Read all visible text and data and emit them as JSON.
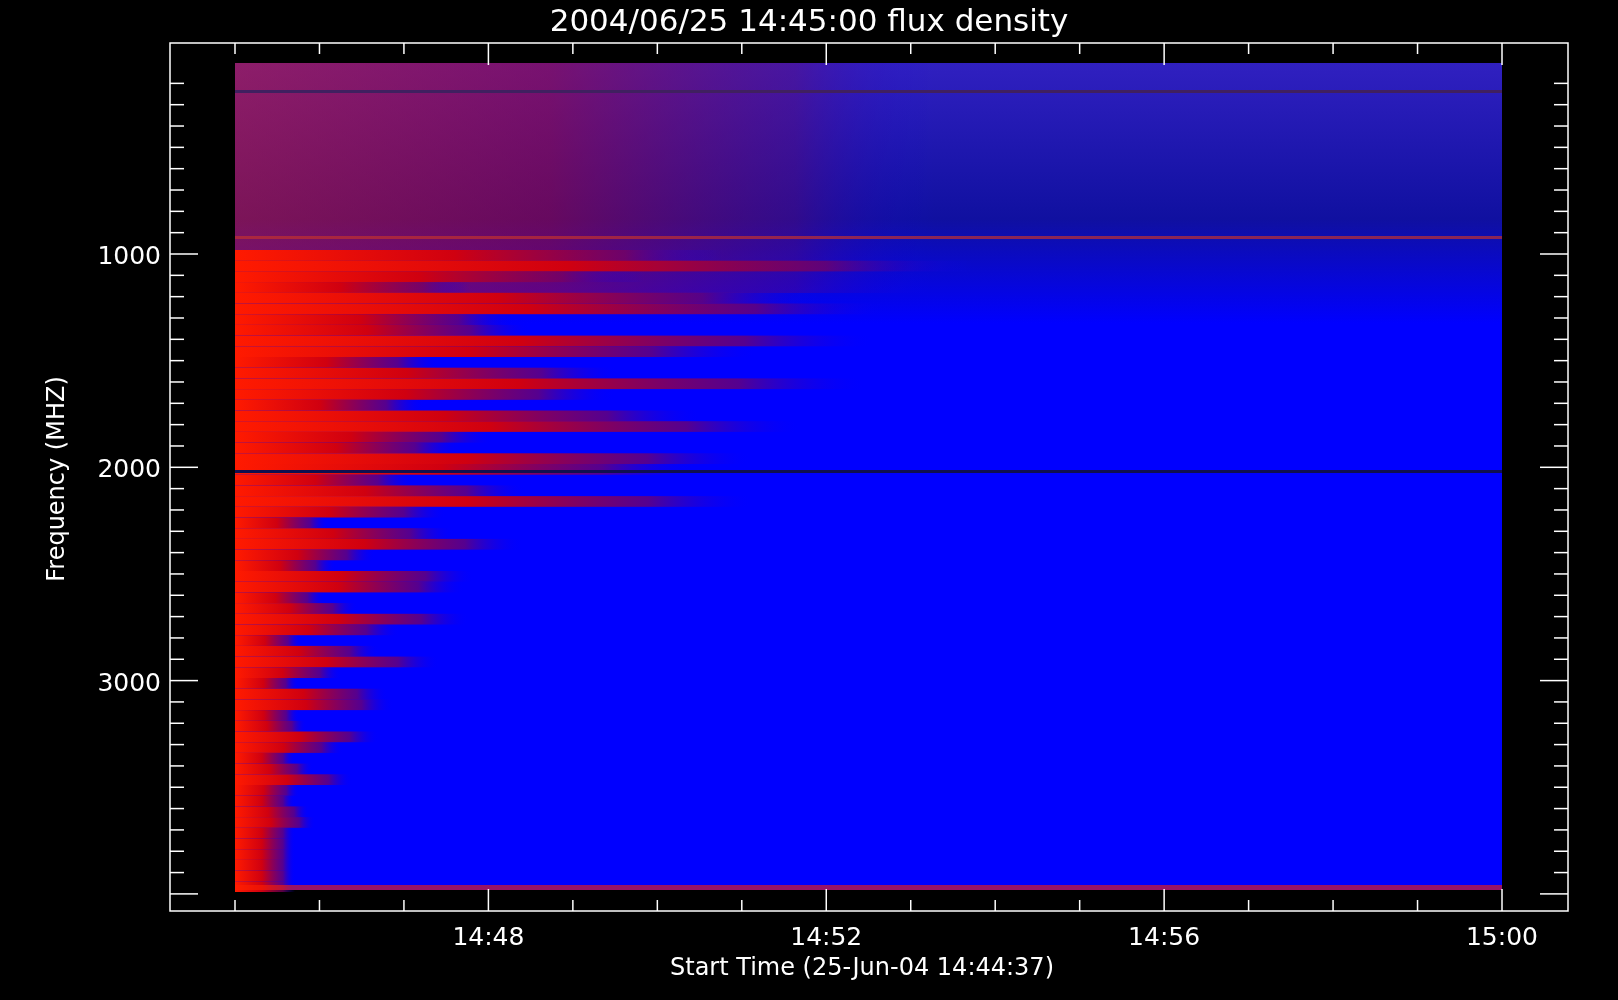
{
  "plot": {
    "title": "2004/06/25 14:45:00 flux density",
    "xlabel": "Start Time (25-Jun-04 14:44:37)",
    "ylabel": "Frequency (MHZ)",
    "x_tick_labels": [
      "14:48",
      "14:52",
      "14:56",
      "15:00"
    ],
    "y_tick_labels": [
      "1000",
      "2000",
      "3000"
    ]
  }
}
